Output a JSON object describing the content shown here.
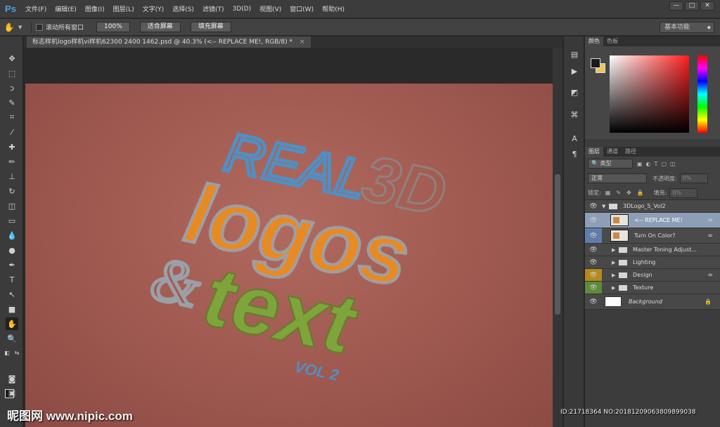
{
  "app": {
    "logo": "Ps"
  },
  "menu": [
    "文件(F)",
    "编辑(E)",
    "图像(I)",
    "图层(L)",
    "文字(Y)",
    "选择(S)",
    "滤镜(T)",
    "3D(D)",
    "视图(V)",
    "窗口(W)",
    "帮助(H)"
  ],
  "window_controls": {
    "minimize": "—",
    "restore": "□",
    "close": "✕"
  },
  "options": {
    "scroll_all_label": "滚动所有窗口",
    "zoom_100": "100%",
    "fit_screen": "适合屏幕",
    "fill_screen": "填充屏幕",
    "workspace": "基本功能"
  },
  "document": {
    "tab_title": "标志样机logo样机vi样机62300 2400 1462.psd @ 40.3% (<-- REPLACE ME!, RGB/8) *",
    "close": "×",
    "art_text": {
      "line1a": "REAL",
      "line1b": "3D",
      "line2": "logos",
      "amp": "&",
      "line3": "text",
      "vol": "VOL 2"
    }
  },
  "colors": {
    "fg": "#1c1c1c",
    "bg": "#e9c75a",
    "canvas": "#a55a50",
    "blue_text": "#4f90c4",
    "orange_text": "#e88a22",
    "green_text": "#7fa43a"
  },
  "color_panel": {
    "tabs": [
      "颜色",
      "色板"
    ]
  },
  "layers_panel": {
    "tabs": [
      "图层",
      "通道",
      "路径"
    ],
    "filter_label": "类型",
    "blend_mode": "正常",
    "opacity_label": "不透明度:",
    "opacity_value": "0%",
    "lock_label": "锁定:",
    "fill_label": "填充:",
    "fill_value": "0%",
    "layers": [
      {
        "name": "3DLogo_5_Vol2",
        "kind": "group-open"
      },
      {
        "name": "<-- REPLACE ME!",
        "kind": "smart",
        "selected": true
      },
      {
        "name": "Turn On Color?",
        "kind": "smart"
      },
      {
        "name": "Master Toning Adjust...",
        "kind": "group"
      },
      {
        "name": "Lighting",
        "kind": "group"
      },
      {
        "name": "Design",
        "kind": "group"
      },
      {
        "name": "Texture",
        "kind": "group"
      },
      {
        "name": "Background",
        "kind": "background"
      }
    ]
  },
  "watermark": {
    "site": "昵图网 www.nipic.com",
    "id": "ID:21718364 NO:20181209063809899038"
  }
}
